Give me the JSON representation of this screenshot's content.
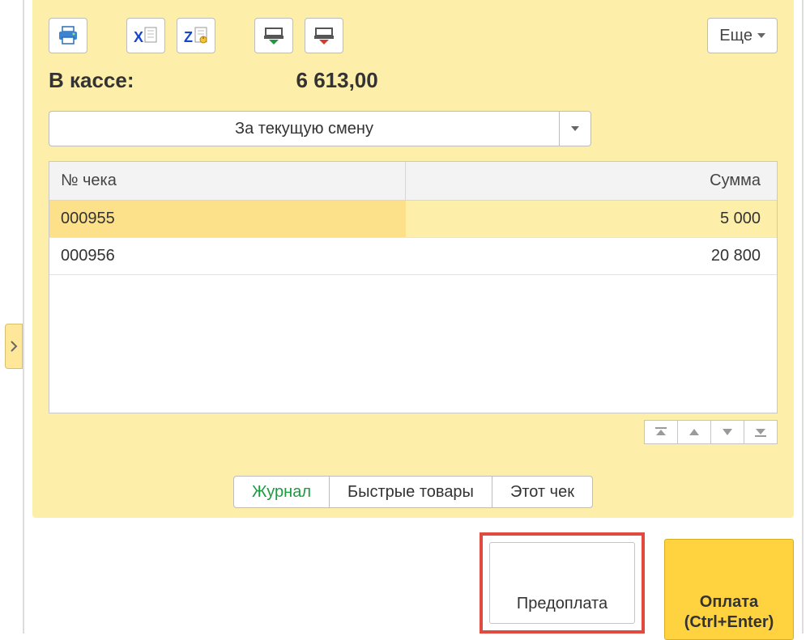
{
  "toolbar": {
    "more_label": "Еще"
  },
  "cash": {
    "label": "В кассе:",
    "value": "6 613,00"
  },
  "filter": {
    "selected": "За текущую смену"
  },
  "grid": {
    "headers": {
      "check": "№ чека",
      "sum": "Сумма"
    },
    "rows": [
      {
        "check": "000955",
        "sum": "5 000"
      },
      {
        "check": "000956",
        "sum": "20 800"
      }
    ]
  },
  "tabs": {
    "journal": "Журнал",
    "quick": "Быстрые товары",
    "this_check": "Этот чек"
  },
  "buttons": {
    "prepay": "Предоплата",
    "pay_line1": "Оплата",
    "pay_line2": "(Ctrl+Enter)"
  }
}
